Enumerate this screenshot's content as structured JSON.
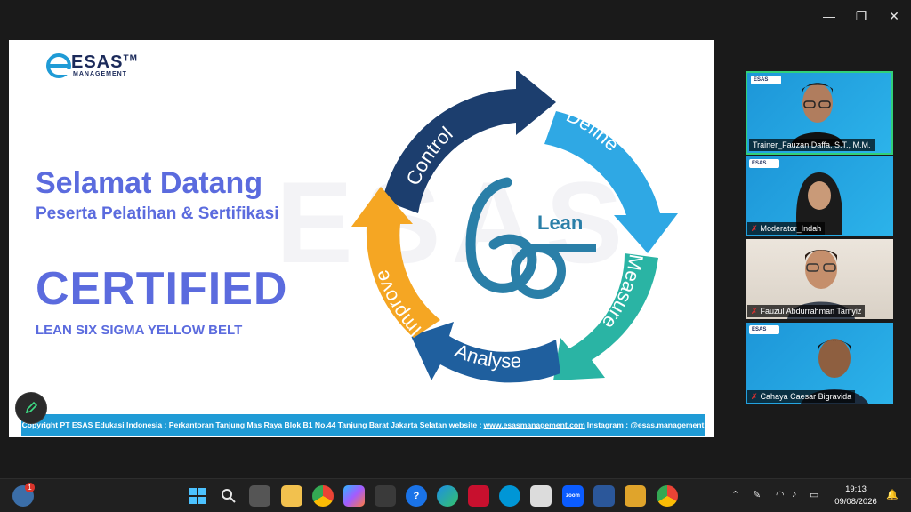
{
  "window": {
    "min": "—",
    "max": "❐",
    "close": "✕"
  },
  "slide": {
    "logo": "ESAS",
    "logo_tm": "TM",
    "logo_sub": "MANAGEMENT",
    "watermark": "ESAS",
    "welcome_title": "Selamat Datang",
    "welcome_subtitle": "Peserta Pelatihan & Sertifikasi",
    "certified": "CERTIFIED",
    "belt": "LEAN SIX SIGMA YELLOW BELT",
    "cycle": {
      "steps": [
        "Control",
        "Define",
        "Measure",
        "Analyse",
        "Improve"
      ],
      "center_label": "Lean"
    },
    "footer": {
      "text_before": "Copyright PT ESAS Edukasi Indonesia : Perkantoran Tanjung Mas Raya Blok B1 No.44 Tanjung Barat Jakarta Selatan website :",
      "link": "www.esasmanagement.com",
      "text_after": "Instagram : @esas.management"
    }
  },
  "participants": [
    {
      "name": "Trainer_Fauzan Daffa, S.T., M.M.",
      "muted": false
    },
    {
      "name": "Moderator_Indah",
      "muted": true
    },
    {
      "name": "Fauzul Abdurrahman Tamyiz",
      "muted": true
    },
    {
      "name": "Cahaya Caesar Bigravida",
      "muted": true
    }
  ],
  "taskbar": {
    "notification_badge": "1",
    "zoom_label": "zoom",
    "time": "19:13",
    "date": "09/08/2026"
  },
  "colors": {
    "accent": "#5b6bde",
    "footer": "#1f9bd6",
    "tile_bg": "#2aa6e0",
    "active_border": "#31d07a"
  }
}
